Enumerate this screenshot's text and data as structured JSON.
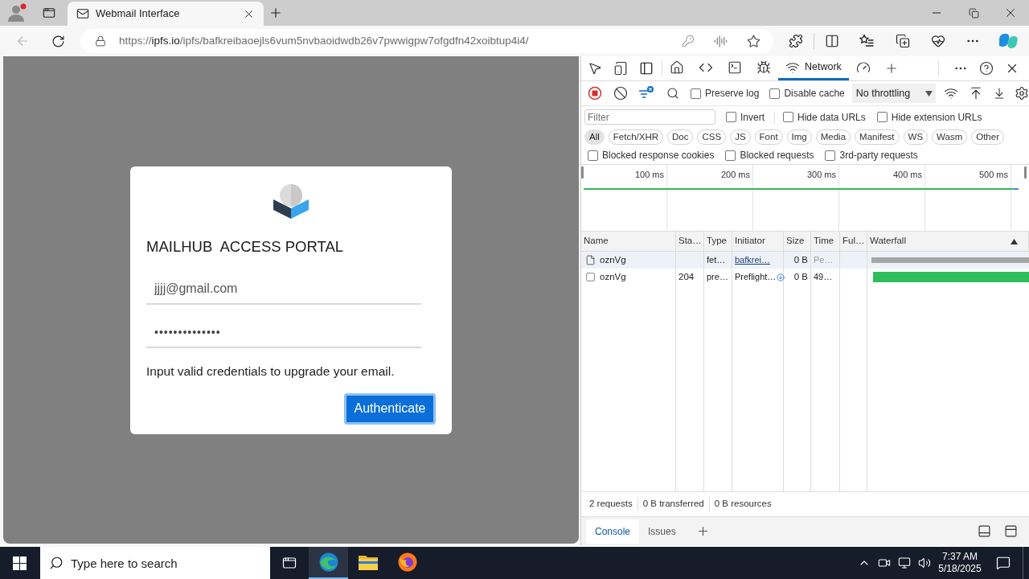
{
  "browser": {
    "tab": {
      "title": "Webmail Interface"
    },
    "url": {
      "scheme": "https://",
      "host": "ipfs.io",
      "path": "/ipfs/bafkreibaoejls6vum5nvbaoidwdb26v7pwwigpw7ofgdfn42xoibtup4i4/"
    }
  },
  "page": {
    "title": "MAILHUB  ACCESS PORTAL",
    "email": {
      "value": "jjjj@gmail.com"
    },
    "password": {
      "value": "••••••••••••••"
    },
    "message": "Input valid credentials to upgrade your email.",
    "button": {
      "label": "Authenticate",
      "focused": true
    }
  },
  "devtools": {
    "panel_tabs": [
      {
        "kind": "home",
        "selected": false
      },
      {
        "kind": "elements",
        "selected": false
      },
      {
        "kind": "console",
        "selected": false
      },
      {
        "kind": "sources",
        "selected": false
      },
      {
        "kind": "network",
        "label": "Network",
        "selected": true
      },
      {
        "kind": "performance",
        "selected": false
      }
    ],
    "toolbar": {
      "recording": true,
      "options": [
        {
          "label": "Preserve log",
          "checked": false
        },
        {
          "label": "Disable cache",
          "checked": false
        }
      ],
      "throttling": "No throttling"
    },
    "filter": {
      "placeholder": "Filter",
      "options": [
        {
          "label": "Invert",
          "checked": false
        },
        {
          "label": "Hide data URLs",
          "checked": false
        },
        {
          "label": "Hide extension URLs",
          "checked": false
        }
      ]
    },
    "type_filters": [
      {
        "label": "All",
        "selected": true
      },
      {
        "label": "Fetch/XHR",
        "selected": false
      },
      {
        "label": "Doc",
        "selected": false
      },
      {
        "label": "CSS",
        "selected": false
      },
      {
        "label": "JS",
        "selected": false
      },
      {
        "label": "Font",
        "selected": false
      },
      {
        "label": "Img",
        "selected": false
      },
      {
        "label": "Media",
        "selected": false
      },
      {
        "label": "Manifest",
        "selected": false
      },
      {
        "label": "WS",
        "selected": false
      },
      {
        "label": "Wasm",
        "selected": false
      },
      {
        "label": "Other",
        "selected": false
      }
    ],
    "more_filters": [
      {
        "label": "Blocked response cookies",
        "checked": false
      },
      {
        "label": "Blocked requests",
        "checked": false
      },
      {
        "label": "3rd-party requests",
        "checked": false
      }
    ],
    "overview": {
      "ticks": [
        "100 ms",
        "200 ms",
        "300 ms",
        "400 ms",
        "500 ms"
      ]
    },
    "table": {
      "columns": [
        "Name",
        "Sta…",
        "Type",
        "Initiator",
        "Size",
        "Time",
        "Ful…",
        "Waterfall"
      ],
      "rows": [
        {
          "kind": "fetch",
          "selected": true,
          "pending": true,
          "name": "oznVg",
          "type": "fet…",
          "initiator": "bafkrei…",
          "size": "0 B",
          "time": "Pe…",
          "color": "#a6a6a6"
        },
        {
          "kind": "preflight",
          "selected": false,
          "pending": false,
          "name": "oznVg",
          "status": "204",
          "type": "pre…",
          "initiator": "Preflight…",
          "size": "0 B",
          "time": "49…",
          "color": "#2ebd59"
        }
      ]
    },
    "status_bar": [
      "2 requests",
      "0 B transferred",
      "0 B resources"
    ],
    "drawer_tabs": [
      {
        "label": "Console",
        "selected": true
      },
      {
        "label": "Issues",
        "selected": false
      }
    ]
  },
  "taskbar": {
    "search": {
      "placeholder": "Type here to search"
    },
    "apps": [
      {
        "kind": "edge",
        "active": true
      },
      {
        "kind": "explorer",
        "active": false
      },
      {
        "kind": "firefox",
        "active": false
      }
    ],
    "time": "7:37 AM",
    "date": "5/18/2025"
  }
}
